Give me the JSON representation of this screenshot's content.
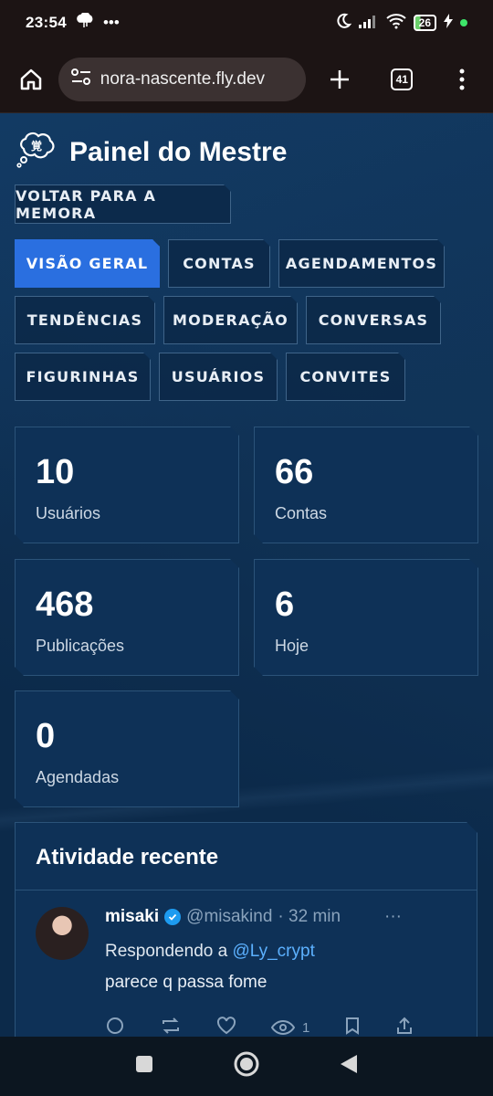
{
  "status_bar": {
    "time": "23:54",
    "battery": "26"
  },
  "browser": {
    "url": "nora-nascente.fly.dev",
    "tab_count": "41"
  },
  "page": {
    "title": "Painel do Mestre",
    "back_button": "VOLTAR PARA A MEMORA",
    "tabs": [
      {
        "label": "VISÃO GERAL",
        "active": true
      },
      {
        "label": "CONTAS"
      },
      {
        "label": "AGENDAMENTOS"
      },
      {
        "label": "TENDÊNCIAS"
      },
      {
        "label": "MODERAÇÃO"
      },
      {
        "label": "CONVERSAS"
      },
      {
        "label": "FIGURINHAS"
      },
      {
        "label": "USUÁRIOS"
      },
      {
        "label": "CONVITES"
      }
    ],
    "stats": [
      {
        "value": "10",
        "label": "Usuários"
      },
      {
        "value": "66",
        "label": "Contas"
      },
      {
        "value": "468",
        "label": "Publicações"
      },
      {
        "value": "6",
        "label": "Hoje"
      },
      {
        "value": "0",
        "label": "Agendadas"
      }
    ],
    "activity": {
      "title": "Atividade recente",
      "post": {
        "name": "misaki",
        "handle": "@misakind",
        "time": "· 32 min",
        "more": "···",
        "reply_prefix": "Respondendo a ",
        "reply_to": "@Ly_crypt",
        "text": "parece q passa fome",
        "views": "1"
      }
    }
  },
  "colors": {
    "accent": "#2a6fe0",
    "background": "#0c2a4a",
    "card": "#0e3157",
    "mention": "#5cb1ff"
  }
}
